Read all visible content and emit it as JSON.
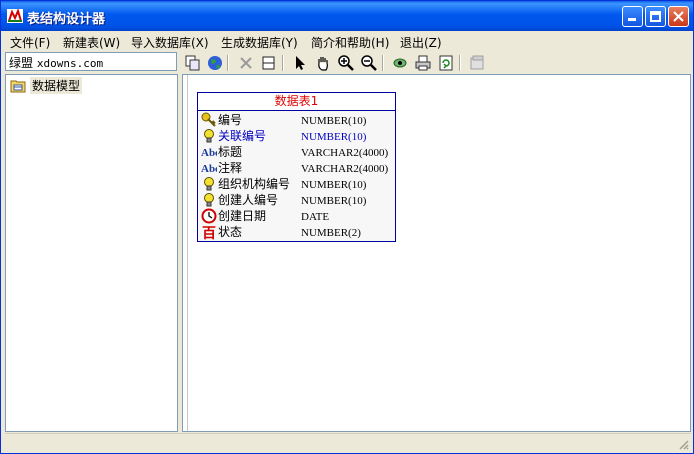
{
  "window": {
    "title": "表结构设计器"
  },
  "menu": [
    {
      "label": "文件(F)"
    },
    {
      "label": "新建表(W)"
    },
    {
      "label": "导入数据库(X)"
    },
    {
      "label": "生成数据库(Y)"
    },
    {
      "label": "简介和帮助(H)"
    },
    {
      "label": "退出(Z)"
    }
  ],
  "left_input": {
    "prefix": "绿盟",
    "value": "xdowns.com"
  },
  "toolbar": {
    "icons": [
      "copy-icon",
      "globe-icon",
      "delete-icon",
      "table-icon",
      "pointer-icon",
      "hand-icon",
      "zoom-in-icon",
      "zoom-out-icon",
      "eye-icon",
      "print-icon",
      "refresh-icon",
      "properties-icon"
    ]
  },
  "tree": {
    "root_label": "数据模型"
  },
  "entity": {
    "title": "数据表1",
    "fields": [
      {
        "name": "编号",
        "type": "NUMBER(10)",
        "icon": "key-icon",
        "highlight": false
      },
      {
        "name": "关联编号",
        "type": "NUMBER(10)",
        "icon": "bulb-icon",
        "highlight": true
      },
      {
        "name": "标题",
        "type": "VARCHAR2(4000)",
        "icon": "abc-icon",
        "highlight": false
      },
      {
        "name": "注释",
        "type": "VARCHAR2(4000)",
        "icon": "abc-icon",
        "highlight": false
      },
      {
        "name": "组织机构编号",
        "type": "NUMBER(10)",
        "icon": "bulb-icon",
        "highlight": false
      },
      {
        "name": "创建人编号",
        "type": "NUMBER(10)",
        "icon": "bulb-icon",
        "highlight": false
      },
      {
        "name": "创建日期",
        "type": "DATE",
        "icon": "clock-icon",
        "highlight": false
      },
      {
        "name": "状态",
        "type": "NUMBER(2)",
        "icon": "hundred-icon",
        "highlight": false
      }
    ]
  },
  "colors": {
    "title_bar": "#0058EE",
    "entity_border": "#0000A0",
    "entity_title": "#E00000",
    "highlight_text": "#0000C0"
  }
}
